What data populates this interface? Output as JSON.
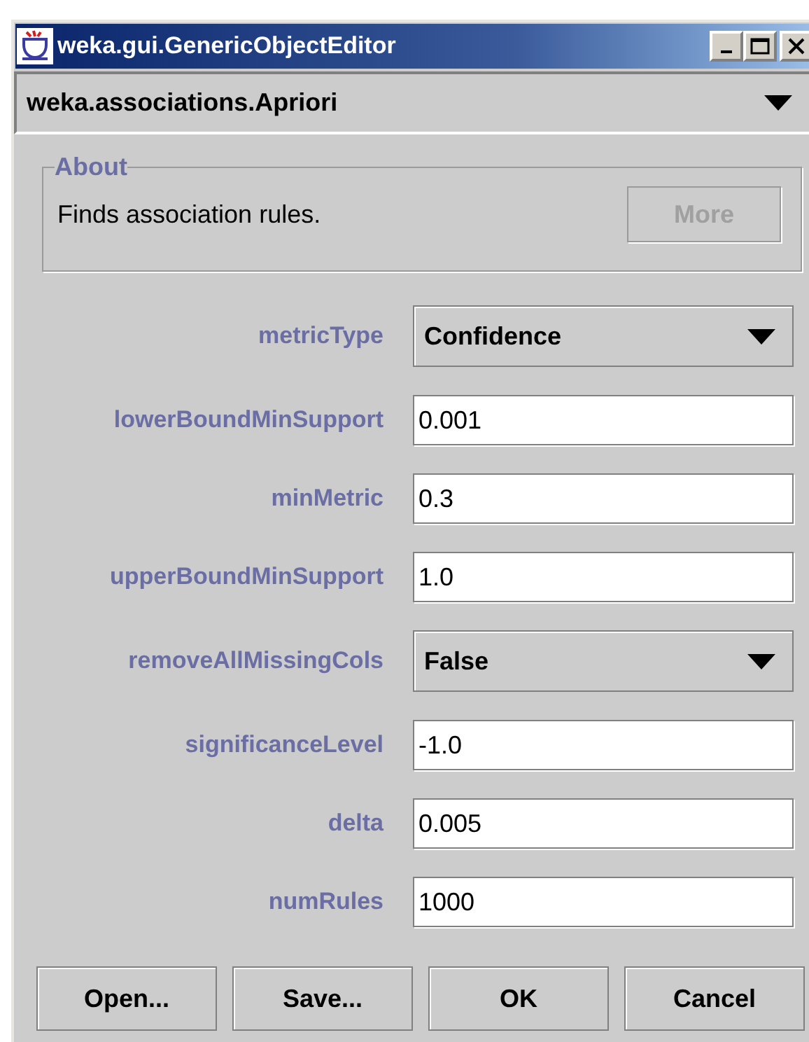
{
  "window": {
    "title": "weka.gui.GenericObjectEditor"
  },
  "class_selector": {
    "value": "weka.associations.Apriori"
  },
  "about": {
    "title": "About",
    "text": "Finds association rules.",
    "more_button": {
      "label": "More",
      "disabled": true
    }
  },
  "properties": [
    {
      "label": "metricType",
      "kind": "choice",
      "value": "Confidence"
    },
    {
      "label": "lowerBoundMinSupport",
      "kind": "text",
      "value": "0.001"
    },
    {
      "label": "minMetric",
      "kind": "text",
      "value": "0.3"
    },
    {
      "label": "upperBoundMinSupport",
      "kind": "text",
      "value": "1.0"
    },
    {
      "label": "removeAllMissingCols",
      "kind": "choice",
      "value": "False"
    },
    {
      "label": "significanceLevel",
      "kind": "text",
      "value": "-1.0"
    },
    {
      "label": "delta",
      "kind": "text",
      "value": "0.005"
    },
    {
      "label": "numRules",
      "kind": "text",
      "value": "1000"
    }
  ],
  "buttons": [
    "Open...",
    "Save...",
    "OK",
    "Cancel"
  ]
}
